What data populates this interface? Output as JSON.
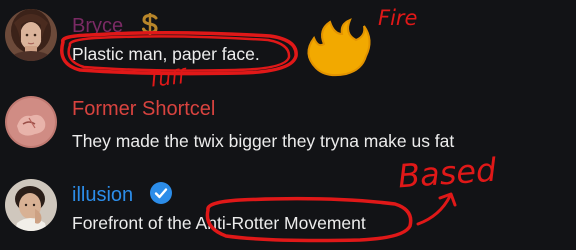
{
  "messages": [
    {
      "username": "Bryce",
      "text": "Plastic man, paper face.",
      "colors": {
        "username": "#7a2a64",
        "badge": "#b8862a"
      },
      "avatar_icon": "woman-portrait-avatar",
      "badge_icon": "dollar-badge-icon"
    },
    {
      "username": "Former Shortcel",
      "text": "They made the twix bigger they tryna make us fat",
      "colors": {
        "username": "#d8433f"
      },
      "avatar_icon": "pink-blob-avatar"
    },
    {
      "username": "illusion",
      "text_parts": [
        "Forefront of the ",
        "Anti-Rotter Movement"
      ],
      "colors": {
        "username": "#2c8de9",
        "badge": "#2c8de9"
      },
      "avatar_icon": "man-portrait-avatar",
      "badge_icon": "verified-check-icon"
    }
  ],
  "annotations": {
    "fire": "Fire",
    "tuff": "Tuff",
    "based": "Based",
    "pen_color": "#e01818",
    "highlight_color": "#f2a900",
    "highlight_icon": "fire-doodle-icon"
  }
}
